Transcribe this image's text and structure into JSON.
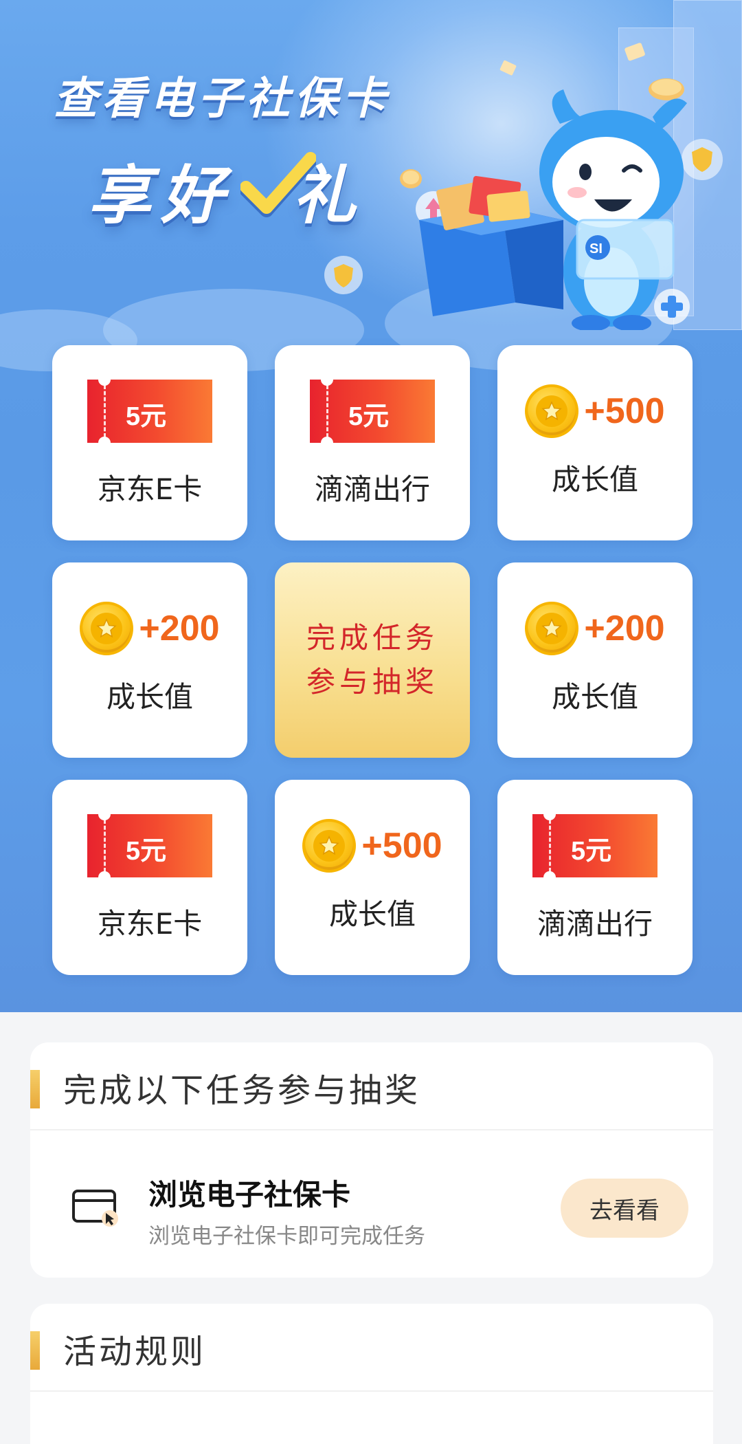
{
  "banner": {
    "title_line1": "查看电子社保卡",
    "title_line2_a": "享好",
    "title_line2_b": "礼",
    "mascot_badge": "SI"
  },
  "prize_grid": [
    {
      "type": "coupon",
      "amount": "5元",
      "label": "京东E卡"
    },
    {
      "type": "coupon",
      "amount": "5元",
      "label": "滴滴出行"
    },
    {
      "type": "points",
      "amount": "+500",
      "label": "成长值"
    },
    {
      "type": "points",
      "amount": "+200",
      "label": "成长值"
    },
    {
      "type": "center",
      "line1": "完成任务",
      "line2": "参与抽奖"
    },
    {
      "type": "points",
      "amount": "+200",
      "label": "成长值"
    },
    {
      "type": "coupon",
      "amount": "5元",
      "label": "京东E卡"
    },
    {
      "type": "points",
      "amount": "+500",
      "label": "成长值"
    },
    {
      "type": "coupon",
      "amount": "5元",
      "label": "滴滴出行"
    }
  ],
  "tasks": {
    "section_title": "完成以下任务参与抽奖",
    "items": [
      {
        "title": "浏览电子社保卡",
        "desc": "浏览电子社保卡即可完成任务",
        "button": "去看看",
        "icon": "card-cursor-icon"
      }
    ]
  },
  "rules": {
    "section_title": "活动规则"
  },
  "colors": {
    "hero_blue": "#5d9de9",
    "coupon_red": "#e8232e",
    "points_orange": "#f0661c",
    "center_red": "#d3262a",
    "button_bg": "#fbe7cc"
  }
}
